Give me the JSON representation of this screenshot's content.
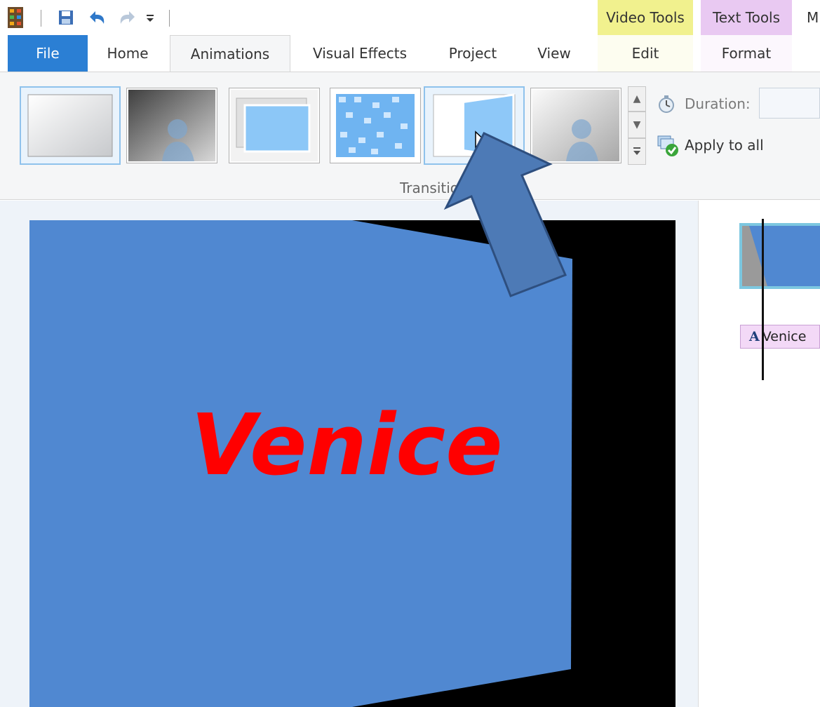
{
  "titlebar": {
    "context_headers": [
      "Video Tools",
      "Text Tools"
    ],
    "title_partial": "M",
    "colors": {
      "video_tools": "#f1f18e",
      "text_tools": "#e9c9f2"
    }
  },
  "tabs": [
    {
      "label": "File"
    },
    {
      "label": "Home"
    },
    {
      "label": "Animations"
    },
    {
      "label": "Visual Effects"
    },
    {
      "label": "Project"
    },
    {
      "label": "View"
    },
    {
      "label": "Edit"
    },
    {
      "label": "Format"
    }
  ],
  "ribbon": {
    "group_label": "Transitio",
    "duration_label": "Duration:",
    "duration_value": "",
    "apply_all_label": "Apply to all"
  },
  "preview": {
    "title_text": "Venice",
    "colors": {
      "slide": "#5088d1",
      "title": "#ff0000",
      "frame": "#000000"
    }
  },
  "storyboard": {
    "caption_icon": "A",
    "caption_text": "Venice"
  },
  "colors": {
    "accent": "#2b7fd4",
    "arrow": "#4d7ab6"
  }
}
